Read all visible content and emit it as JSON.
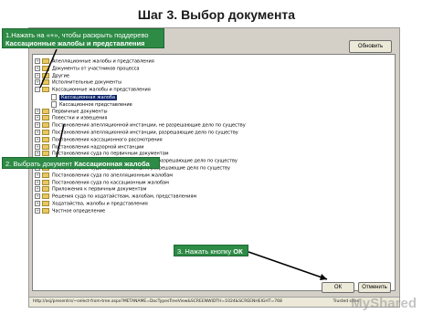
{
  "page_title": "Шаг 3. Выбор документа",
  "toolbar": {
    "refresh_label": "Обновить"
  },
  "tree_items": [
    {
      "label": "Апелляционные жалобы и представления",
      "expander": "+"
    },
    {
      "label": "Документы от участников процесса",
      "expander": "+"
    },
    {
      "label": "Другие",
      "expander": "+"
    },
    {
      "label": "Исполнительные документы",
      "expander": "+"
    },
    {
      "label": "Кассационные жалобы и представления",
      "expander": "−"
    },
    {
      "label": "Кассационная жалоба",
      "selected": true
    },
    {
      "label": "Кассационное представление"
    },
    {
      "label": "Первичные документы",
      "expander": "+"
    },
    {
      "label": "Повестки и извещения",
      "expander": "+"
    },
    {
      "label": "Постановления апелляционной инстанции, не разрешающие дело по существу",
      "expander": "+"
    },
    {
      "label": "Постановления апелляционной инстанции, разрешающие дело по существу",
      "expander": "+"
    },
    {
      "label": "Постановления кассационного рассмотрения",
      "expander": "+"
    },
    {
      "label": "Постановления надзорной инстанции",
      "expander": "+"
    },
    {
      "label": "Постановления суда по первичным документам",
      "expander": "+"
    },
    {
      "label": "Постановления суда первой инстанции, не разрешающие дело по существу",
      "expander": "+"
    },
    {
      "label": "Постановления суда первой инстанции, разрешающие дело по существу",
      "expander": "+"
    },
    {
      "label": "Постановления суда по апелляционным жалобам",
      "expander": "+"
    },
    {
      "label": "Постановления суда по кассационным жалобам",
      "expander": "+"
    },
    {
      "label": "Приложения к первичным документам",
      "expander": "+"
    },
    {
      "label": "Решения суда по ходатайствам, жалобам, представлениям",
      "expander": "+"
    },
    {
      "label": "Ходатайства, жалобы и представления",
      "expander": "+"
    },
    {
      "label": "Частное определение",
      "expander": "+"
    }
  ],
  "buttons": {
    "ok": "ОК",
    "cancel": "Отменить"
  },
  "status_bar": {
    "url": "http://asj/presentrs/~select-from-tree.aspx?METANAME=DocTypesTreeView&SCREENWIDTH=1024&SCREENHEIGHT=768",
    "zone": "Trusted sites"
  },
  "callouts": {
    "c1_line1": "1.Нажать на «+», чтобы раскрыть поддерево",
    "c1_line2": "Кассационные жалобы и представления",
    "c2_prefix": "2. Выбрать документ ",
    "c2_bold": "Кассационная жалоба",
    "c3_prefix": "3. Нажать кнопку ",
    "c3_bold": "ОК"
  },
  "watermark": "MyShared",
  "colors": {
    "callout_bg": "#2d8b45",
    "selection": "#0a246a",
    "window_bg": "#d4d0c8"
  }
}
